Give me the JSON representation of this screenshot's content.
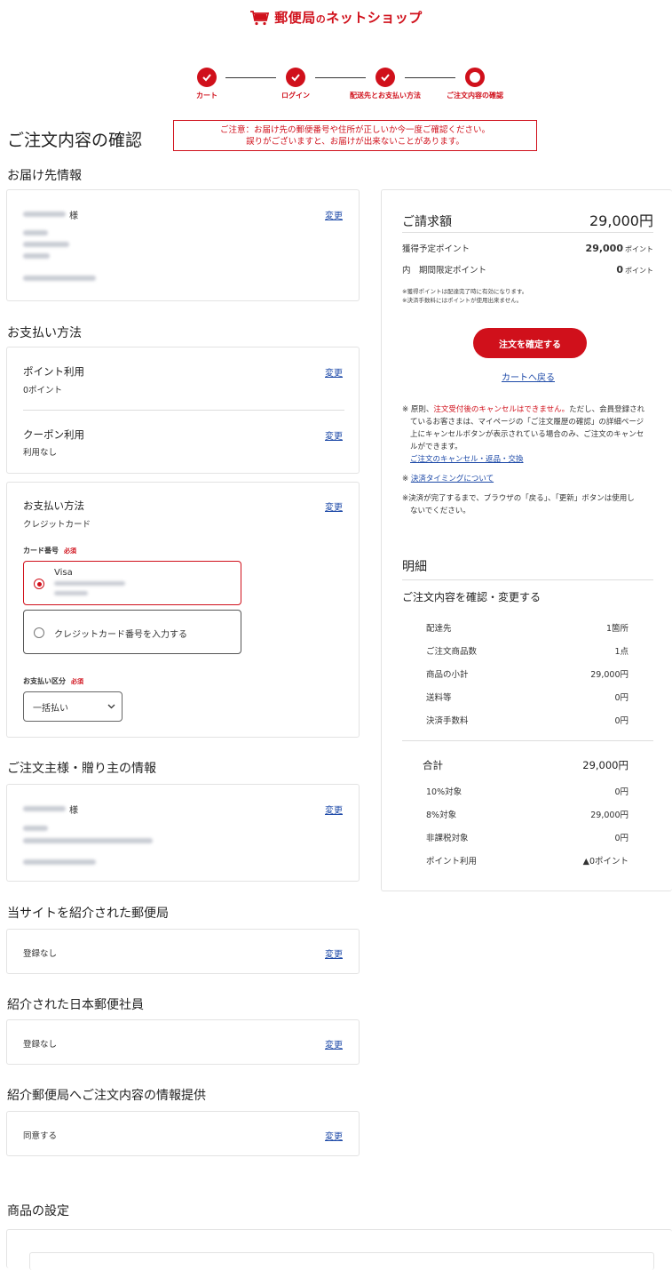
{
  "header": {
    "brand_main": "郵便局",
    "brand_no": "の",
    "brand_sub": "ネットショップ"
  },
  "steps": [
    {
      "label": "カート",
      "state": "done"
    },
    {
      "label": "ログイン",
      "state": "done"
    },
    {
      "label": "配送先とお支払い方法",
      "state": "done"
    },
    {
      "label": "ご注文内容の確認",
      "state": "current"
    }
  ],
  "page_title": "ご注文内容の確認",
  "notice": {
    "line1": "ご注意：お届け先の郵便番号や住所が正しいか今一度ご確認ください。",
    "line2": "誤りがございますと、お届けが出来ないことがあります。"
  },
  "delivery": {
    "section_title": "お届け先情報",
    "name_suffix": "様",
    "change": "変更"
  },
  "payment": {
    "section_title": "お支払い方法",
    "points_label": "ポイント利用",
    "points_value": "0ポイント",
    "coupon_label": "クーポン利用",
    "coupon_value": "利用なし",
    "method_label": "お支払い方法",
    "method_value": "クレジットカード",
    "card_number_label": "カード番号",
    "required": "必須",
    "card_brand": "Visa",
    "new_card_label": "クレジットカード番号を入力する",
    "installment_label": "お支払い区分",
    "installment_value": "一括払い",
    "change": "変更"
  },
  "orderer": {
    "section_title": "ご注文主様・贈り主の情報",
    "name_suffix": "様",
    "change": "変更"
  },
  "referral_office": {
    "section_title": "当サイトを紹介された郵便局",
    "value": "登録なし",
    "change": "変更"
  },
  "referral_staff": {
    "section_title": "紹介された日本郵便社員",
    "value": "登録なし",
    "change": "変更"
  },
  "info_provision": {
    "section_title": "紹介郵便局へご注文内容の情報提供",
    "value": "同意する",
    "change": "変更"
  },
  "product_settings": {
    "section_title": "商品の設定"
  },
  "summary": {
    "billing_label": "ご請求額",
    "billing_amount": "29,000円",
    "earned_points_label": "獲得予定ポイント",
    "earned_points_value": "29,000",
    "limited_points_label": "内　期間限定ポイント",
    "limited_points_value": "0",
    "points_unit": "ポイント",
    "small_note1": "※獲得ポイントは配達完了時に有効になります。",
    "small_note2": "※決済手数料にはポイントが使用出来ません。",
    "confirm_button": "注文を確定する",
    "back_to_cart": "カートへ戻る",
    "cancel_note_prefix": "※ 原則、",
    "cancel_note_red": "注文受付後のキャンセルはできません。",
    "cancel_note_rest1": "ただし、会員登録され",
    "cancel_note_line2": "ているお客さまは、マイページの「ご注文履歴の確認」の詳細ページ",
    "cancel_note_line3": "上にキャンセルボタンが表示されている場合のみ、ご注文のキャンセ",
    "cancel_note_line4": "ルができます。",
    "cancel_link": "ご注文のキャンセル・返品・交換",
    "timing_prefix": "※",
    "timing_link": "決済タイミングについて",
    "warning_line1": "※決済が完了するまで、ブラウザの「戻る」、「更新」ボタンは使用し",
    "warning_line2": "ないでください。"
  },
  "details": {
    "title": "明細",
    "subtitle": "ご注文内容を確認・変更する",
    "rows": [
      {
        "label": "配達先",
        "value": "1箇所"
      },
      {
        "label": "ご注文商品数",
        "value": "1点"
      },
      {
        "label": "商品の小計",
        "value": "29,000円"
      },
      {
        "label": "送料等",
        "value": "0円"
      },
      {
        "label": "決済手数料",
        "value": "0円"
      }
    ],
    "total_label": "合計",
    "total_value": "29,000円",
    "tax_rows": [
      {
        "label": "10%対象",
        "value": "0円"
      },
      {
        "label": "8%対象",
        "value": "29,000円"
      },
      {
        "label": "非課税対象",
        "value": "0円"
      },
      {
        "label": "ポイント利用",
        "value": "▲0ポイント"
      }
    ]
  },
  "colors": {
    "accent": "#d0101b",
    "link": "#1e4aa8"
  }
}
